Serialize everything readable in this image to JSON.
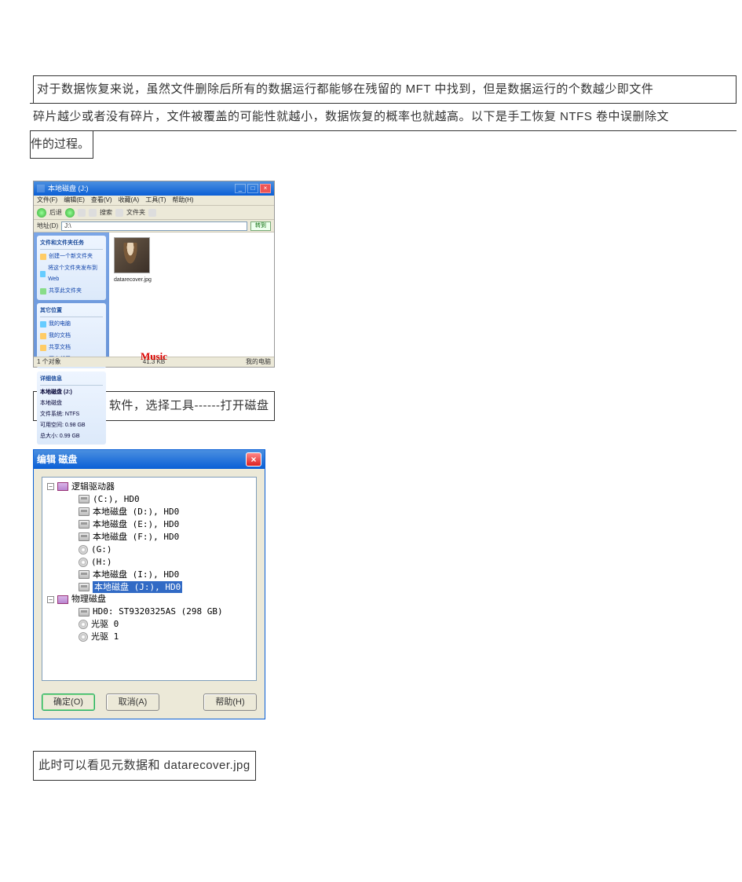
{
  "para": {
    "l1": "对于数据恢复来说，虽然文件删除后所有的数据运行都能够在残留的 MFT 中找到，但是数据运行的个数越少即文件",
    "l2": "碎片越少或者没有碎片，文件被覆盖的可能性就越小，数据恢复的概率也就越高。以下是手工恢复 NTFS 卷中误删除文",
    "l3": "件的过程。"
  },
  "shot1": {
    "title": "本地磁盘 (J:)",
    "menu": [
      "文件(F)",
      "编辑(E)",
      "查看(V)",
      "收藏(A)",
      "工具(T)",
      "帮助(H)"
    ],
    "toolbar": {
      "back": "后退",
      "search": "搜索",
      "folders": "文件夹"
    },
    "address_label": "地址(D)",
    "address_value": "J:\\",
    "go": "转到",
    "panels": {
      "tasks": {
        "title": "文件和文件夹任务",
        "items": [
          "创建一个新文件夹",
          "将这个文件夹发布到 Web",
          "共享此文件夹"
        ]
      },
      "other": {
        "title": "其它位置",
        "items": [
          "我的电脑",
          "我的文档",
          "共享文档",
          "网上邻居"
        ]
      },
      "details": {
        "title": "详细信息",
        "name": "本地磁盘 (J:)",
        "type": "本地磁盘",
        "fs": "文件系统: NTFS",
        "free": "可用空间: 0.98 GB",
        "total": "总大小: 0.99 GB"
      }
    },
    "file": {
      "name": "datarecover.jpg"
    },
    "status": {
      "left": "1 个对象",
      "mid": "41.3 KB",
      "right": "我的电脑"
    },
    "music": "Music"
  },
  "step1": "打开 winhex 软件，选择工具------打开磁盘",
  "dlg": {
    "title": "编辑 磁盘",
    "tree": {
      "logical": "逻辑驱动器",
      "items": [
        "(C:), HD0",
        "本地磁盘  (D:), HD0",
        "本地磁盘  (E:), HD0",
        "本地磁盘  (F:), HD0",
        "(G:)",
        "(H:)",
        "本地磁盘  (I:), HD0",
        "本地磁盘  (J:), HD0"
      ],
      "physical": "物理磁盘",
      "hd": "HD0: ST9320325AS (298 GB)",
      "cd0": "光驱 0",
      "cd1": "光驱 1"
    },
    "buttons": {
      "ok": "确定(O)",
      "cancel": "取消(A)",
      "help": "帮助(H)"
    }
  },
  "step2": "此时可以看见元数据和 datarecover.jpg"
}
